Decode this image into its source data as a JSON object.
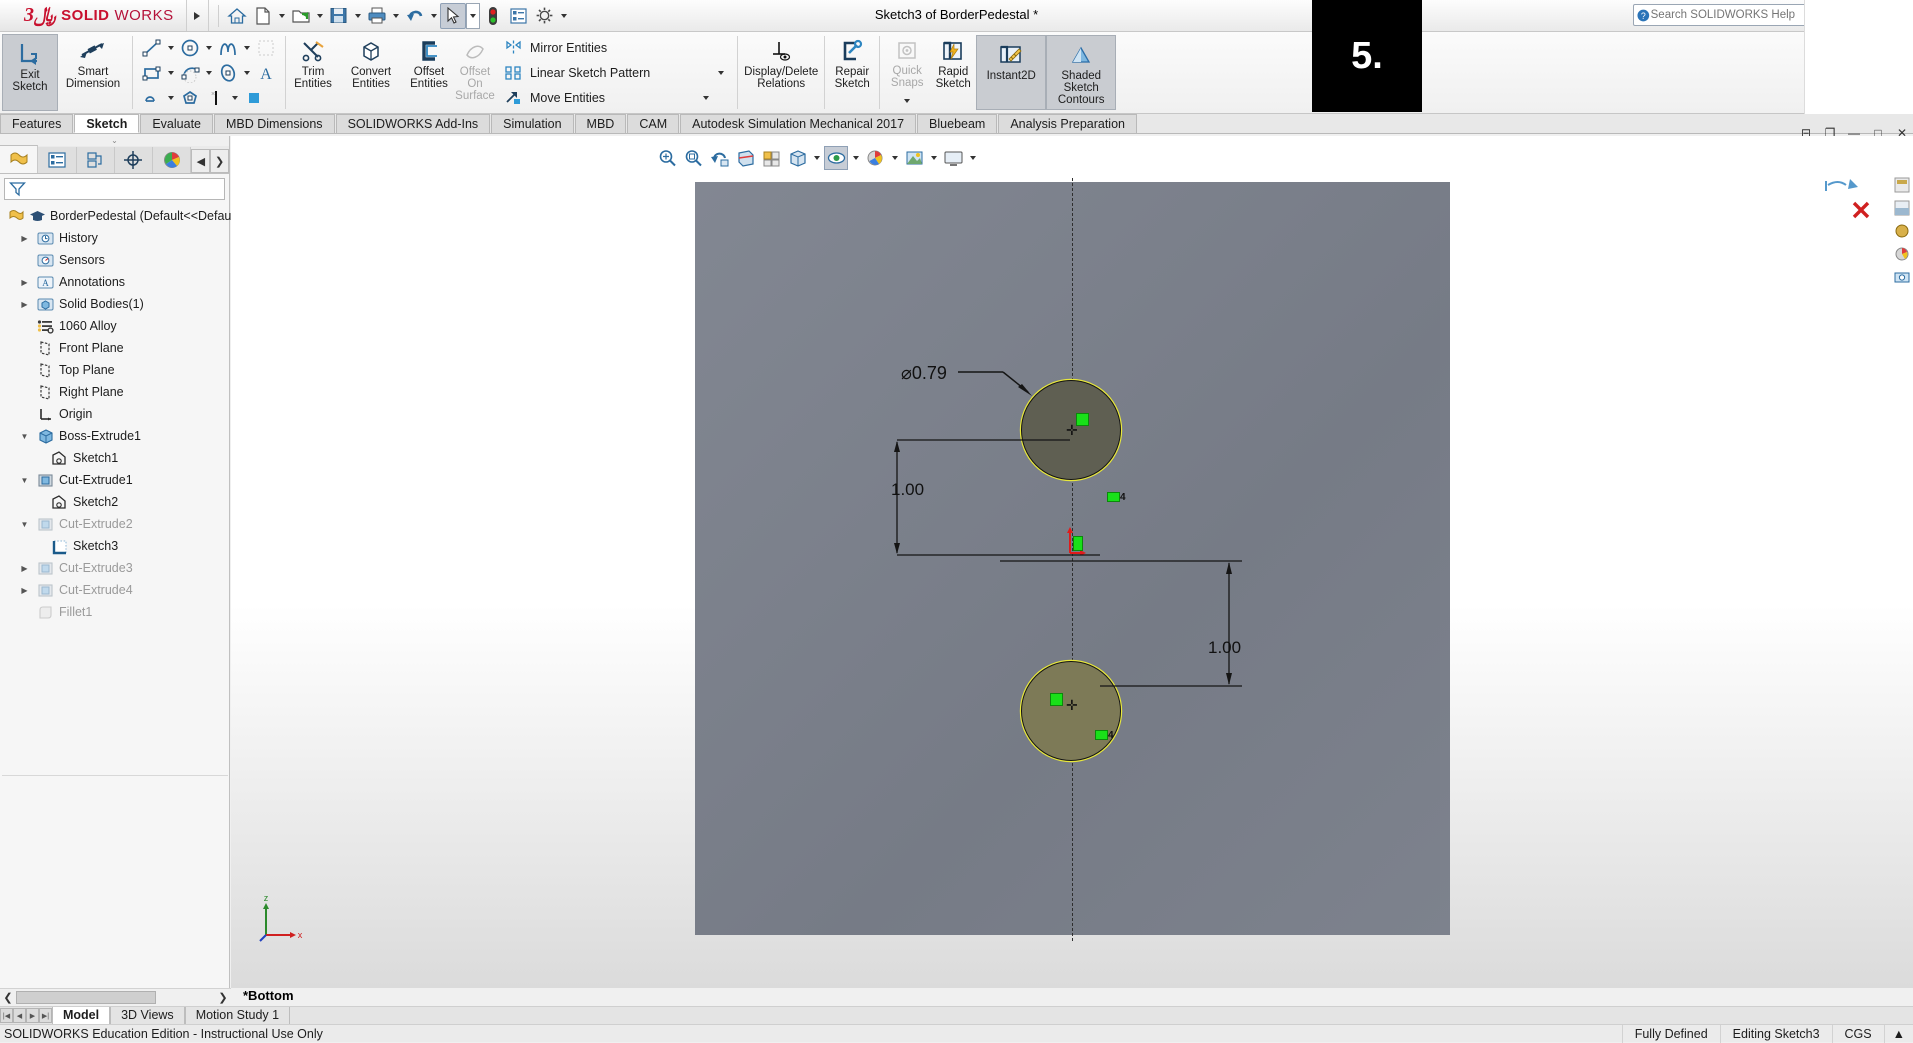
{
  "window": {
    "title": "Sketch3 of BorderPedestal *",
    "overlay_number": "5.",
    "minimize": "—",
    "maximize": "□",
    "close": "✕"
  },
  "quick_access": {
    "menu_expand_icon": "triangle-right-icon",
    "items": [
      {
        "name": "home-icon",
        "label": "Home"
      },
      {
        "name": "new-document-icon",
        "label": "New"
      },
      {
        "name": "open-folder-icon",
        "label": "Open"
      },
      {
        "name": "save-icon",
        "label": "Save"
      },
      {
        "name": "print-icon",
        "label": "Print"
      },
      {
        "name": "undo-icon",
        "label": "Undo"
      },
      {
        "name": "select-cursor-icon",
        "label": "Select"
      },
      {
        "name": "rebuild-traffic-icon",
        "label": "Rebuild"
      },
      {
        "name": "options-list-icon",
        "label": "Options"
      },
      {
        "name": "gear-icon",
        "label": "Settings"
      }
    ]
  },
  "search": {
    "placeholder": "Search SOLIDWORKS Help",
    "value": "",
    "icon": "help-search-icon",
    "user_icon": "user-account-icon",
    "help_icon": "question-mark-icon"
  },
  "ribbon": {
    "exit_sketch": "Exit\nSketch",
    "exit_sketch_l1": "Exit",
    "exit_sketch_l2": "Sketch",
    "smart_dimension_l1": "Smart",
    "smart_dimension_l2": "Dimension",
    "trim_entities_l1": "Trim",
    "trim_entities_l2": "Entities",
    "convert_entities_l1": "Convert",
    "convert_entities_l2": "Entities",
    "offset_entities_l1": "Offset",
    "offset_entities_l2": "Entities",
    "offset_on_surface_l1": "Offset",
    "offset_on_surface_l2": "On",
    "offset_on_surface_l3": "Surface",
    "mirror_entities": "Mirror Entities",
    "linear_sketch_pattern": "Linear Sketch Pattern",
    "move_entities": "Move Entities",
    "display_delete_relations_l1": "Display/Delete",
    "display_delete_relations_l2": "Relations",
    "repair_sketch_l1": "Repair",
    "repair_sketch_l2": "Sketch",
    "quick_snaps_l1": "Quick",
    "quick_snaps_l2": "Snaps",
    "rapid_sketch_l1": "Rapid",
    "rapid_sketch_l2": "Sketch",
    "instant2d": "Instant2D",
    "shaded_sketch_l1": "Shaded",
    "shaded_sketch_l2": "Sketch",
    "shaded_sketch_l3": "Contours",
    "sketch_tools": [
      "line-icon",
      "circle-icon",
      "spline-icon",
      "rectangle-icon",
      "arc-icon",
      "ellipse-icon",
      "slot-icon",
      "polygon-icon",
      "point-icon",
      "fillet-icon",
      "trim-icon",
      "text-icon"
    ]
  },
  "command_tabs": [
    {
      "label": "Features",
      "active": false
    },
    {
      "label": "Sketch",
      "active": true
    },
    {
      "label": "Evaluate",
      "active": false
    },
    {
      "label": "MBD Dimensions",
      "active": false
    },
    {
      "label": "SOLIDWORKS Add-Ins",
      "active": false
    },
    {
      "label": "Simulation",
      "active": false
    },
    {
      "label": "MBD",
      "active": false
    },
    {
      "label": "CAM",
      "active": false
    },
    {
      "label": "Autodesk Simulation Mechanical 2017",
      "active": false
    },
    {
      "label": "Bluebeam",
      "active": false
    },
    {
      "label": "Analysis Preparation",
      "active": false
    }
  ],
  "panel_tabs": [
    {
      "name": "feature-manager-tab",
      "icon": "feature-tree-icon",
      "active": true
    },
    {
      "name": "property-manager-tab",
      "icon": "property-list-icon",
      "active": false
    },
    {
      "name": "configuration-manager-tab",
      "icon": "configuration-icon",
      "active": false
    },
    {
      "name": "dimxpert-manager-tab",
      "icon": "dimxpert-target-icon",
      "active": false
    },
    {
      "name": "display-manager-tab",
      "icon": "display-sphere-icon",
      "active": false
    }
  ],
  "filter": {
    "placeholder": "",
    "value": "",
    "icon": "filter-funnel-icon"
  },
  "tree": [
    {
      "label": "BorderPedestal  (Default<<Defaul",
      "icon": "part-icon",
      "indent": 0,
      "expander": "",
      "dim": false,
      "extra_icon": "graduation-cap-icon"
    },
    {
      "label": "History",
      "icon": "history-icon",
      "indent": 1,
      "expander": "▶",
      "dim": false
    },
    {
      "label": "Sensors",
      "icon": "sensors-icon",
      "indent": 1,
      "expander": "",
      "dim": false
    },
    {
      "label": "Annotations",
      "icon": "annotations-icon",
      "indent": 1,
      "expander": "▶",
      "dim": false
    },
    {
      "label": "Solid Bodies(1)",
      "icon": "solid-bodies-icon",
      "indent": 1,
      "expander": "▶",
      "dim": false
    },
    {
      "label": "1060 Alloy",
      "icon": "material-icon",
      "indent": 1,
      "expander": "",
      "dim": false
    },
    {
      "label": "Front Plane",
      "icon": "plane-icon",
      "indent": 1,
      "expander": "",
      "dim": false
    },
    {
      "label": "Top Plane",
      "icon": "plane-icon",
      "indent": 1,
      "expander": "",
      "dim": false
    },
    {
      "label": "Right Plane",
      "icon": "plane-icon",
      "indent": 1,
      "expander": "",
      "dim": false
    },
    {
      "label": "Origin",
      "icon": "origin-icon",
      "indent": 1,
      "expander": "",
      "dim": false
    },
    {
      "label": "Boss-Extrude1",
      "icon": "boss-extrude-icon",
      "indent": 1,
      "expander": "▼",
      "dim": false
    },
    {
      "label": "Sketch1",
      "icon": "sketch-icon",
      "indent": 2,
      "expander": "",
      "dim": false
    },
    {
      "label": "Cut-Extrude1",
      "icon": "cut-extrude-icon",
      "indent": 1,
      "expander": "▼",
      "dim": false
    },
    {
      "label": "Sketch2",
      "icon": "sketch-icon",
      "indent": 2,
      "expander": "",
      "dim": false
    },
    {
      "label": "Cut-Extrude2",
      "icon": "cut-extrude-icon",
      "indent": 1,
      "expander": "▼",
      "dim": true
    },
    {
      "label": "Sketch3",
      "icon": "active-sketch-icon",
      "indent": 2,
      "expander": "",
      "dim": false
    },
    {
      "label": "Cut-Extrude3",
      "icon": "cut-extrude-icon",
      "indent": 1,
      "expander": "▶",
      "dim": true
    },
    {
      "label": "Cut-Extrude4",
      "icon": "cut-extrude-icon",
      "indent": 1,
      "expander": "▶",
      "dim": true
    },
    {
      "label": "Fillet1",
      "icon": "fillet-icon",
      "indent": 1,
      "expander": "",
      "dim": true
    }
  ],
  "view_toolbar": [
    {
      "name": "zoom-to-fit-icon",
      "caret": false,
      "selected": false
    },
    {
      "name": "zoom-to-area-icon",
      "caret": false,
      "selected": false
    },
    {
      "name": "previous-view-icon",
      "caret": false,
      "selected": false
    },
    {
      "name": "section-view-icon",
      "caret": false,
      "selected": false
    },
    {
      "name": "view-orientation-icon",
      "caret": false,
      "selected": false
    },
    {
      "name": "display-style-icon",
      "caret": true,
      "selected": false
    },
    {
      "name": "hide-show-items-icon",
      "caret": true,
      "selected": true
    },
    {
      "name": "edit-appearance-icon",
      "caret": true,
      "selected": false
    },
    {
      "name": "apply-scene-icon",
      "caret": true,
      "selected": false
    },
    {
      "name": "view-settings-icon",
      "caret": true,
      "selected": false
    }
  ],
  "right_toolbar": [
    {
      "name": "confirm-corner-sketch-icon"
    },
    {
      "name": "cancel-red-x-icon"
    },
    {
      "name": "appearance-panel-icon"
    },
    {
      "name": "scene-panel-icon"
    },
    {
      "name": "decal-panel-icon"
    },
    {
      "name": "light-panel-icon"
    },
    {
      "name": "camera-panel-icon"
    }
  ],
  "sketch": {
    "diameter_dimension": "0.79",
    "diameter_symbol": "⌀",
    "diameter_label": "⌀0.79",
    "vertical_dim_top": "1.00",
    "vertical_dim_bottom": "1.00",
    "relation_glyph_top": "4",
    "relation_glyph_bottom": "4",
    "view_label": "*Bottom",
    "triad_x": "x",
    "triad_z": "z"
  },
  "bottom": {
    "doc_tabs": [
      {
        "label": "Model",
        "active": true
      },
      {
        "label": "3D Views",
        "active": false
      },
      {
        "label": "Motion Study 1",
        "active": false
      }
    ],
    "nav_first": "|◀",
    "nav_prev": "◀",
    "nav_next": "▶",
    "nav_last": "▶|"
  },
  "status": {
    "left": "SOLIDWORKS Education Edition - Instructional Use Only",
    "fully_defined": "Fully Defined",
    "editing": "Editing Sketch3",
    "units": "CGS",
    "units_caret": "▲"
  }
}
